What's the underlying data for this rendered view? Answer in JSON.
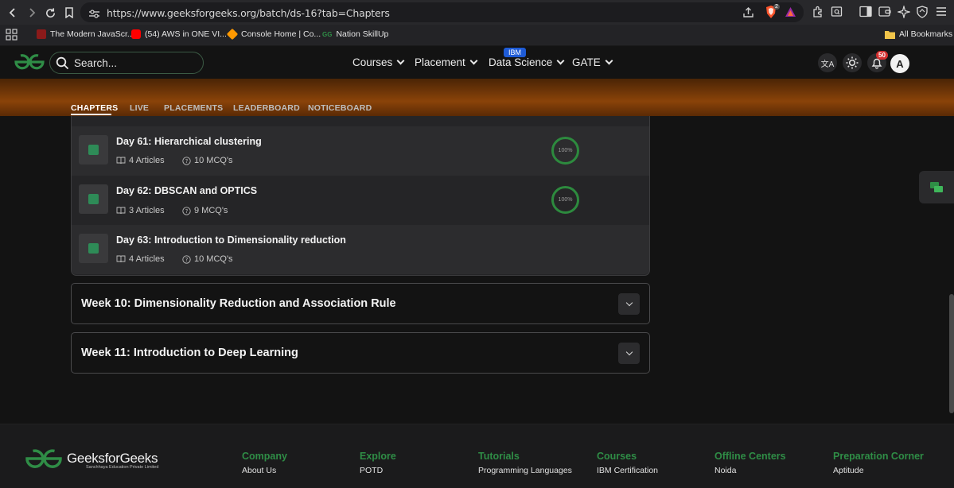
{
  "browser": {
    "url": "https://www.geeksforgeeks.org/batch/ds-16?tab=Chapters",
    "shield_badge": "2",
    "bookmarks": [
      {
        "label": "The Modern JavaScr...",
        "color": "#d33"
      },
      {
        "label": "(54) AWS in ONE VI...",
        "color": "#ff0000"
      },
      {
        "label": "Console Home | Co...",
        "color": "#ff9900"
      },
      {
        "label": "Nation SkillUp",
        "color": "#2f8d46"
      }
    ],
    "all_bookmarks": "All Bookmarks"
  },
  "header": {
    "search_placeholder": "Search...",
    "nav": [
      "Courses",
      "Placement",
      "Data Science",
      "GATE"
    ],
    "ibm_badge": "IBM",
    "notification_count": "50",
    "avatar_letter": "A"
  },
  "tabs": [
    "CHAPTERS",
    "LIVE",
    "PLACEMENTS",
    "LEADERBOARD",
    "NOTICEBOARD"
  ],
  "days": [
    {
      "title": "Day 61: Hierarchical clustering",
      "articles": "4 Articles",
      "mcqs": "10 MCQ's",
      "progress": "100%"
    },
    {
      "title": "Day 62: DBSCAN and OPTICS",
      "articles": "3 Articles",
      "mcqs": "9 MCQ's",
      "progress": "100%"
    },
    {
      "title": "Day 63: Introduction to Dimensionality reduction",
      "articles": "4 Articles",
      "mcqs": "10 MCQ's",
      "progress": ""
    }
  ],
  "weeks": [
    {
      "title": "Week 10: Dimensionality Reduction and Association Rule"
    },
    {
      "title": "Week 11: Introduction to Deep Learning"
    }
  ],
  "footer": {
    "brand": "GeeksforGeeks",
    "brand_sub": "Sanchhaya Education Private Limited",
    "columns": [
      {
        "heading": "Company",
        "items": [
          "About Us"
        ]
      },
      {
        "heading": "Explore",
        "items": [
          "POTD"
        ]
      },
      {
        "heading": "Tutorials",
        "items": [
          "Programming Languages"
        ]
      },
      {
        "heading": "Courses",
        "items": [
          "IBM Certification"
        ]
      },
      {
        "heading": "Offline Centers",
        "items": [
          "Noida"
        ]
      },
      {
        "heading": "Preparation Corner",
        "items": [
          "Aptitude"
        ]
      }
    ]
  },
  "colors": {
    "brand_green": "#2f8d46",
    "progress_green": "#2d8a3e",
    "banner_orange": "#8a4309"
  }
}
